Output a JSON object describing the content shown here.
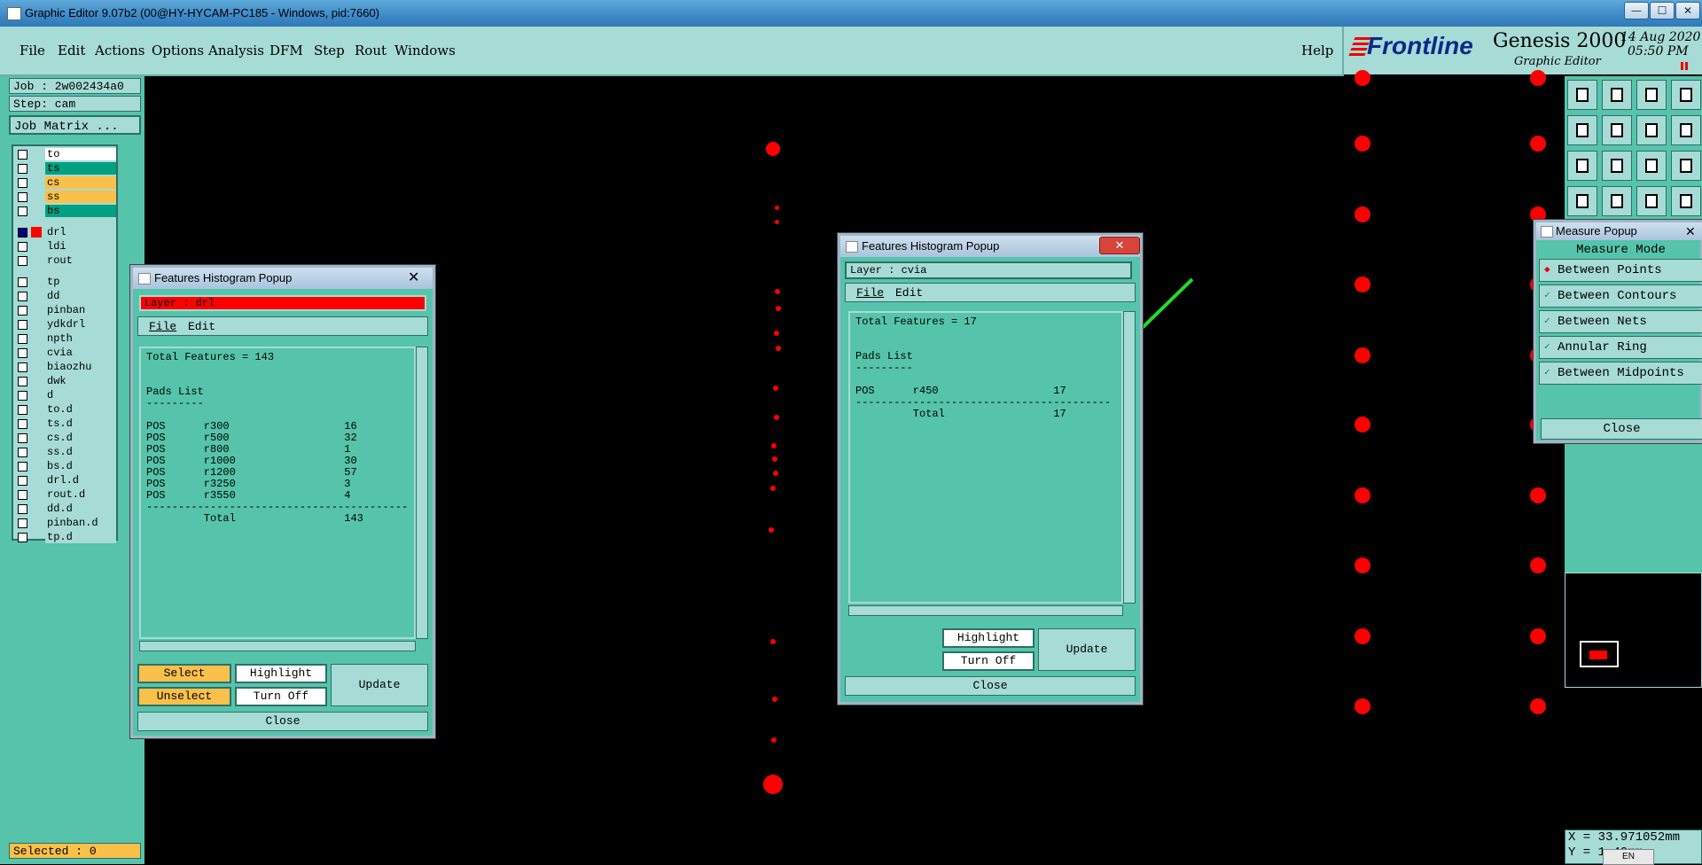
{
  "window": {
    "title": "Graphic Editor 9.07b2 (00@HY-HYCAM-PC185 - Windows, pid:7660)",
    "btn_min": "—",
    "btn_max": "☐",
    "btn_close": "✕"
  },
  "menu": [
    "File",
    "Edit",
    "Actions",
    "Options",
    "Analysis",
    "DFM",
    "Step",
    "Rout",
    "Windows"
  ],
  "help": "Help",
  "brand": {
    "logo": "Frontline",
    "product": "Genesis 2000",
    "subtitle": "Graphic Editor",
    "date": "14 Aug 2020",
    "time": "05:50 PM"
  },
  "job": {
    "job_label": "Job : 2w002434a0",
    "step_label": "Step: cam",
    "matrix_button": "Job Matrix ..."
  },
  "layers": [
    {
      "name": "to",
      "color": "#ffffff"
    },
    {
      "name": "ts",
      "color": "#00a080"
    },
    {
      "name": "cs",
      "color": "#f9c04a"
    },
    {
      "name": "ss",
      "color": "#f9c04a"
    },
    {
      "name": "bs",
      "color": "#00a080"
    },
    {
      "name": "drl",
      "color": "#a6dbd6",
      "active": true
    },
    {
      "name": "ldi",
      "color": "#a6dbd6"
    },
    {
      "name": "rout",
      "color": "#a6dbd6"
    },
    {
      "name": "tp",
      "color": "#a6dbd6"
    },
    {
      "name": "dd",
      "color": "#a6dbd6"
    },
    {
      "name": "pinban",
      "color": "#a6dbd6"
    },
    {
      "name": "ydkdrl",
      "color": "#a6dbd6"
    },
    {
      "name": "npth",
      "color": "#a6dbd6"
    },
    {
      "name": "cvia",
      "color": "#a6dbd6"
    },
    {
      "name": "biaozhu",
      "color": "#a6dbd6"
    },
    {
      "name": "dwk",
      "color": "#a6dbd6"
    },
    {
      "name": "d",
      "color": "#a6dbd6"
    },
    {
      "name": "to.d",
      "color": "#a6dbd6"
    },
    {
      "name": "ts.d",
      "color": "#a6dbd6"
    },
    {
      "name": "cs.d",
      "color": "#a6dbd6"
    },
    {
      "name": "ss.d",
      "color": "#a6dbd6"
    },
    {
      "name": "bs.d",
      "color": "#a6dbd6"
    },
    {
      "name": "drl.d",
      "color": "#a6dbd6"
    },
    {
      "name": "rout.d",
      "color": "#a6dbd6"
    },
    {
      "name": "dd.d",
      "color": "#a6dbd6"
    },
    {
      "name": "pinban.d",
      "color": "#a6dbd6"
    },
    {
      "name": "tp.d",
      "color": "#a6dbd6"
    }
  ],
  "selected": "Selected : 0",
  "hist1": {
    "title": "Features Histogram Popup",
    "layer": "Layer :  drl",
    "menu_file": "File",
    "menu_edit": "Edit",
    "content": "Total Features = 143\n\n\nPads List\n---------\n\nPOS      r300                  16\nPOS      r500                  32\nPOS      r800                  1\nPOS      r1000                 30\nPOS      r1200                 57\nPOS      r3250                 3\nPOS      r3550                 4\n-----------------------------------------\n         Total                 143",
    "select": "Select",
    "unselect": "Unselect",
    "highlight": "Highlight",
    "turn_off": "Turn Off",
    "update": "Update",
    "close": "Close"
  },
  "hist2": {
    "title": "Features Histogram Popup",
    "layer": "Layer :  cvia",
    "menu_file": "File",
    "menu_edit": "Edit",
    "content": "Total Features = 17\n\n\nPads List\n---------\n\nPOS      r450                  17\n----------------------------------------\n         Total                 17",
    "highlight": "Highlight",
    "turn_off": "Turn Off",
    "update": "Update",
    "close": "Close"
  },
  "measure": {
    "title": "Measure Popup",
    "mode_label": "Measure Mode",
    "options": [
      "Between Points",
      "Between Contours",
      "Between Nets",
      "Annular Ring",
      "Between Midpoints"
    ],
    "selected_index": 0,
    "close": "Close"
  },
  "coords": {
    "x": "X = 33.971052mm",
    "y": "Y = 1        40mm"
  },
  "ime": "EN",
  "colors": {
    "pad": "#ff0000",
    "panel": "#55c4aa",
    "light": "#a6dbd6",
    "arrow": "#22dd22"
  }
}
